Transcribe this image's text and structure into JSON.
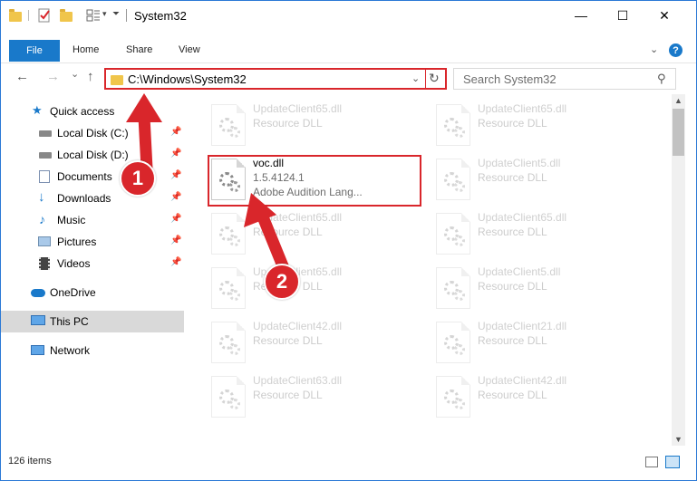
{
  "window": {
    "title": "System32",
    "controls": {
      "minimize": "—",
      "maximize": "☐",
      "close": "✕"
    }
  },
  "ribbon": {
    "tabs": [
      "File",
      "Home",
      "Share",
      "View"
    ],
    "help": "?"
  },
  "nav": {
    "back": "←",
    "forward": "→",
    "recent": "⌄",
    "up": "↑",
    "address": "C:\\Windows\\System32",
    "search_placeholder": "Search System32"
  },
  "sidebar": {
    "items": [
      {
        "label": "Quick access",
        "icon": "star-icon",
        "pinned": false
      },
      {
        "label": "Local Disk (C:)",
        "icon": "drive-icon",
        "pinned": true
      },
      {
        "label": "Local Disk (D:)",
        "icon": "drive-icon",
        "pinned": true
      },
      {
        "label": "Documents",
        "icon": "documents-icon",
        "pinned": true
      },
      {
        "label": "Downloads",
        "icon": "download-icon",
        "pinned": true
      },
      {
        "label": "Music",
        "icon": "music-icon",
        "pinned": true
      },
      {
        "label": "Pictures",
        "icon": "pictures-icon",
        "pinned": true
      },
      {
        "label": "Videos",
        "icon": "videos-icon",
        "pinned": true
      },
      {
        "label": "OneDrive",
        "icon": "cloud-icon",
        "pinned": false
      },
      {
        "label": "This PC",
        "icon": "pc-icon",
        "pinned": false,
        "selected": true
      },
      {
        "label": "Network",
        "icon": "network-icon",
        "pinned": false
      }
    ]
  },
  "files": {
    "highlighted": {
      "name": "voc.dll",
      "version": "1.5.4124.1",
      "description": "Adobe Audition Lang..."
    },
    "faded_left": [
      {
        "name": "UpdateClient65.dll",
        "type": "Resource DLL"
      },
      {
        "name": "UpdateClient65.dll",
        "type": "Resource DLL"
      },
      {
        "name": "UpdateClient65.dll",
        "type": "Resource DLL"
      },
      {
        "name": "UpdateClient42.dll",
        "type": "Resource DLL"
      },
      {
        "name": "UpdateClient63.dll",
        "type": "Resource DLL"
      }
    ],
    "faded_right": [
      {
        "name": "UpdateClient65.dll",
        "type": "Resource DLL"
      },
      {
        "name": "UpdateClient5.dll",
        "type": "Resource DLL"
      },
      {
        "name": "UpdateClient65.dll",
        "type": "Resource DLL"
      },
      {
        "name": "UpdateClient5.dll",
        "type": "Resource DLL"
      },
      {
        "name": "UpdateClient21.dll",
        "type": "Resource DLL"
      },
      {
        "name": "UpdateClient42.dll",
        "type": "Resource DLL"
      }
    ]
  },
  "status": {
    "item_count": "126 items"
  },
  "callouts": {
    "step1": "1",
    "step2": "2"
  },
  "colors": {
    "accent": "#1979ca",
    "callout_red": "#d9262b",
    "folder_yellow": "#f0c54b"
  }
}
